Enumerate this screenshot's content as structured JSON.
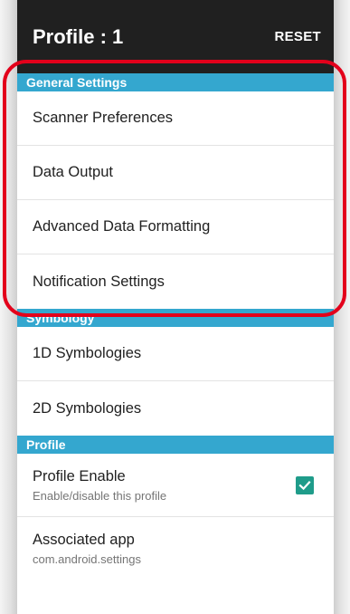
{
  "appbar": {
    "title": "Profile : 1",
    "action": "RESET"
  },
  "sections": {
    "general": {
      "header": "General Settings",
      "items": [
        "Scanner Preferences",
        "Data Output",
        "Advanced Data Formatting",
        "Notification Settings"
      ]
    },
    "symbology": {
      "header": "Symbology",
      "items": [
        "1D Symbologies",
        "2D Symbologies"
      ]
    },
    "profile": {
      "header": "Profile",
      "enable": {
        "title": "Profile Enable",
        "summary": "Enable/disable this profile",
        "checked": true
      },
      "associated": {
        "title": "Associated app",
        "summary": "com.android.settings"
      }
    }
  },
  "colors": {
    "appbar": "#202020",
    "section_header": "#34a7cf",
    "checkbox": "#1f9c8a",
    "highlight": "#e3001b"
  },
  "icons": {
    "checkbox": "check-icon"
  }
}
